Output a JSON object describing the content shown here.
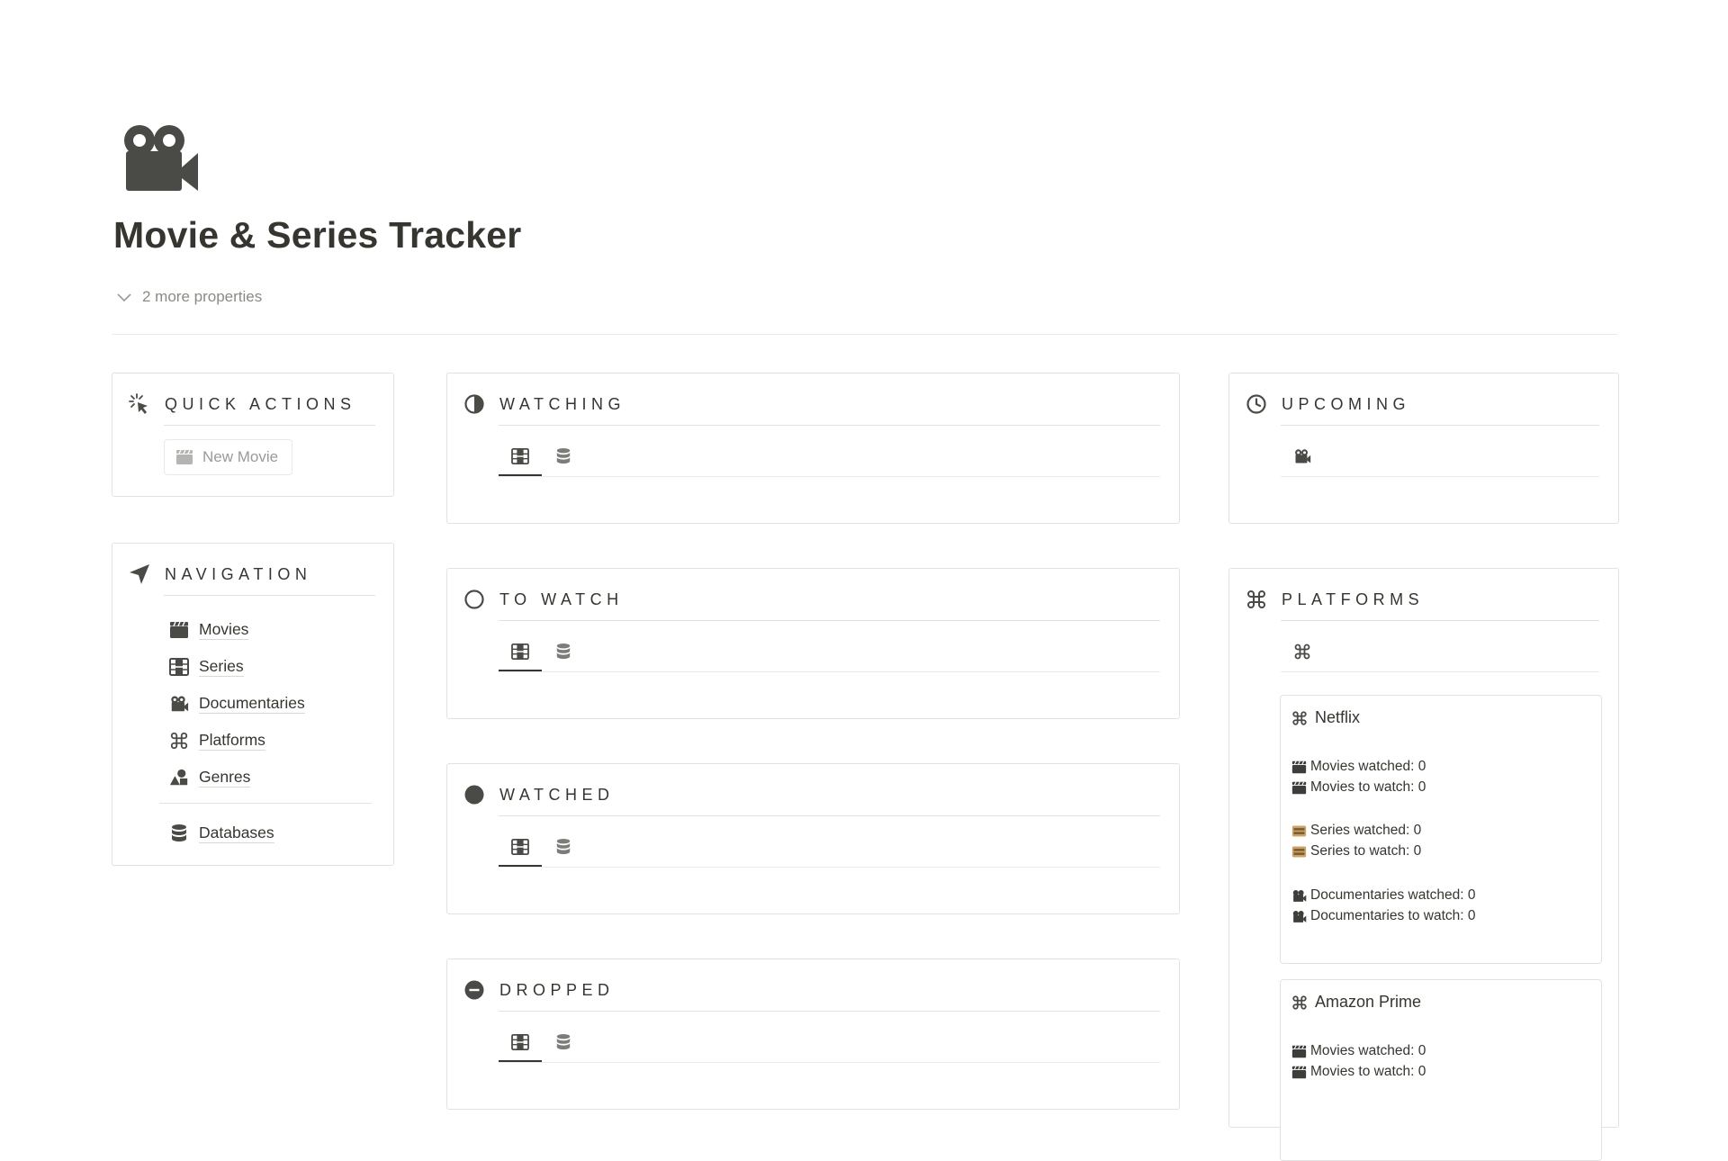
{
  "page": {
    "title": "Movie & Series Tracker",
    "more_properties": "2 more properties",
    "icon": "movie-camera-icon"
  },
  "quick_actions": {
    "title": "QUICK ACTIONS",
    "icon": "cursor-click-icon",
    "new_movie_label": "New Movie"
  },
  "navigation": {
    "title": "NAVIGATION",
    "icon": "navigation-arrow-icon",
    "items": [
      {
        "label": "Movies",
        "icon": "clapperboard-icon"
      },
      {
        "label": "Series",
        "icon": "film-strip-icon"
      },
      {
        "label": "Documentaries",
        "icon": "movie-camera-icon"
      },
      {
        "label": "Platforms",
        "icon": "command-icon"
      },
      {
        "label": "Genres",
        "icon": "shapes-icon"
      }
    ],
    "footer_item": {
      "label": "Databases",
      "icon": "database-icon"
    }
  },
  "sections": [
    {
      "title": "WATCHING",
      "icon": "half-circle-icon"
    },
    {
      "title": "TO WATCH",
      "icon": "empty-circle-icon"
    },
    {
      "title": "WATCHED",
      "icon": "filled-circle-icon"
    },
    {
      "title": "DROPPED",
      "icon": "minus-circle-icon"
    }
  ],
  "upcoming": {
    "title": "UPCOMING",
    "icon": "clock-icon"
  },
  "platforms": {
    "title": "PLATFORMS",
    "icon": "command-icon",
    "cards": [
      {
        "name": "Netflix",
        "lines": [
          "Movies watched: 0",
          "Movies to watch: 0",
          "Series watched: 0",
          "Series to watch: 0",
          "Documentaries watched: 0",
          "Documentaries to watch: 0"
        ]
      },
      {
        "name": "Amazon Prime",
        "lines": [
          "Movies watched: 0",
          "Movies to watch: 0"
        ]
      }
    ]
  },
  "colors": {
    "text": "#37352f",
    "muted": "#9b9a97",
    "border": "#e3e2e0",
    "icon": "#4a4a46"
  }
}
